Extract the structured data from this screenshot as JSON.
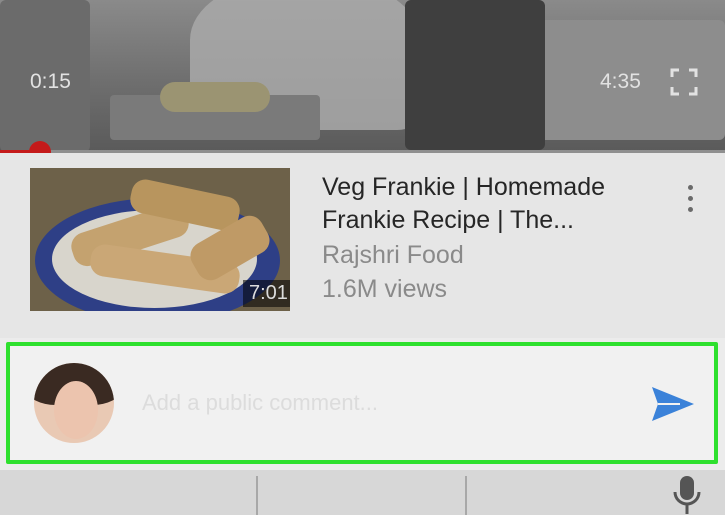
{
  "player": {
    "current_time": "0:15",
    "total_time": "4:35",
    "progress": 0.055,
    "fullscreen_icon": "fullscreen-icon",
    "accent": "#c41a1a"
  },
  "suggested_video": {
    "title": "Veg Frankie | Homemade Frankie Recipe | The...",
    "channel": "Rajshri Food",
    "views": "1.6M views",
    "duration": "7:01",
    "more_icon": "more-vert-icon"
  },
  "comment": {
    "placeholder": "Add a public comment...",
    "value": "",
    "send_icon": "send-icon",
    "send_color": "#3b82d9",
    "highlight_color": "#2ee02e"
  },
  "keyboard": {
    "mic_icon": "mic-icon"
  }
}
